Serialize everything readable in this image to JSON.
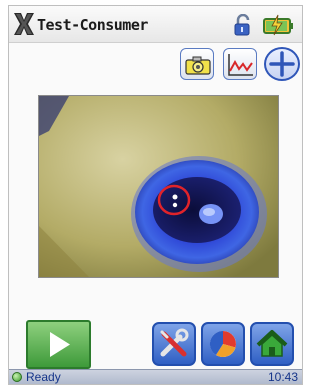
{
  "app": {
    "title": "Test-Consumer"
  },
  "toolbar": {
    "icons": [
      "camera-icon",
      "graph-icon",
      "plus-icon"
    ]
  },
  "bottom_bar": {
    "icons": [
      "play-icon",
      "tools-icon",
      "pie-chart-icon",
      "home-icon"
    ]
  },
  "status": {
    "text": "Ready",
    "time": "10:43"
  },
  "colors": {
    "accent_blue": "#2f5fc4",
    "play_green": "#3e9a3a",
    "highlight_ring": "#e0232a"
  }
}
